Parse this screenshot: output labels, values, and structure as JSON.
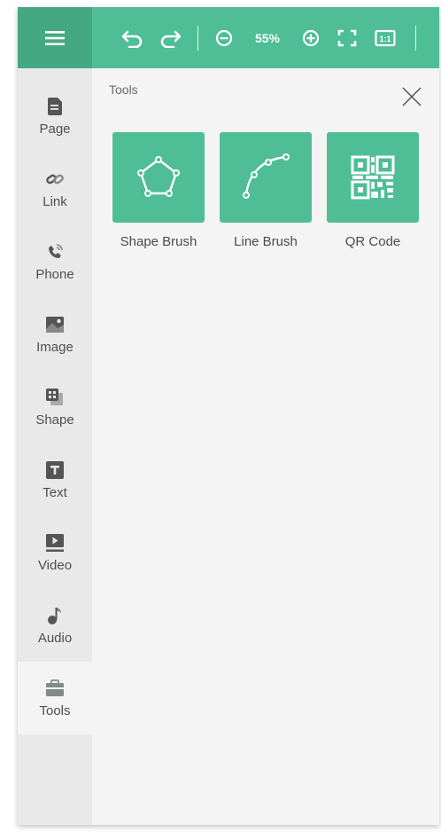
{
  "toolbar": {
    "zoom_level": "55%",
    "icons": [
      "menu-icon",
      "undo-icon",
      "redo-icon",
      "zoom-out-icon",
      "zoom-in-icon",
      "fullscreen-icon",
      "actual-size-icon"
    ],
    "actual_size_label": "1:1"
  },
  "sidebar": {
    "items": [
      {
        "label": "Page",
        "icon": "page-icon"
      },
      {
        "label": "Link",
        "icon": "link-icon"
      },
      {
        "label": "Phone",
        "icon": "phone-icon"
      },
      {
        "label": "Image",
        "icon": "image-icon"
      },
      {
        "label": "Shape",
        "icon": "shape-icon"
      },
      {
        "label": "Text",
        "icon": "text-icon"
      },
      {
        "label": "Video",
        "icon": "video-icon"
      },
      {
        "label": "Audio",
        "icon": "audio-icon"
      },
      {
        "label": "Tools",
        "icon": "toolbox-icon",
        "active": true
      }
    ]
  },
  "panel": {
    "title": "Tools",
    "tools": [
      {
        "label": "Shape Brush",
        "icon": "pentagon-brush-icon"
      },
      {
        "label": "Line Brush",
        "icon": "curve-brush-icon"
      },
      {
        "label": "QR Code",
        "icon": "qr-code-icon"
      }
    ]
  },
  "colors": {
    "accent": "#4fbe96",
    "accent_dark": "#44a983",
    "sidebar_bg": "#e9e9e9",
    "panel_bg": "#f4f4f4",
    "icon_gray": "#555555"
  }
}
